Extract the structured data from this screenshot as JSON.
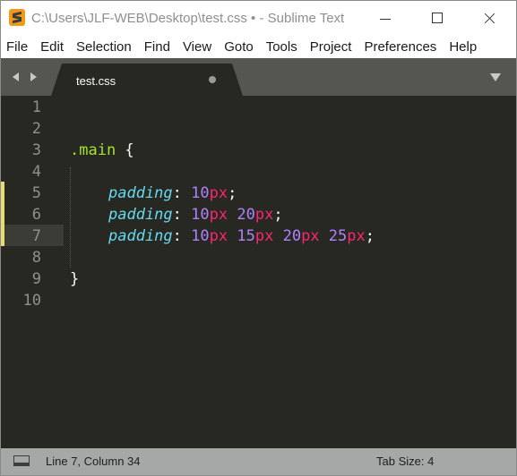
{
  "window": {
    "title": "C:\\Users\\JLF-WEB\\Desktop\\test.css • - Sublime Text"
  },
  "menu": [
    "File",
    "Edit",
    "Selection",
    "Find",
    "View",
    "Goto",
    "Tools",
    "Project",
    "Preferences",
    "Help"
  ],
  "tab": {
    "label": "test.css",
    "dirty": true
  },
  "editor": {
    "line_numbers": [
      "1",
      "2",
      "3",
      "4",
      "5",
      "6",
      "7",
      "8",
      "9",
      "10"
    ],
    "modified_lines": [
      5,
      6,
      7
    ],
    "current_line": 7,
    "code": {
      "l3_selector": ".main",
      "l3_brace": " {",
      "l5_prop": "padding",
      "l5_colon": ": ",
      "l5_n1": "10",
      "l5_u1": "px",
      "l5_end": ";",
      "l6_prop": "padding",
      "l6_colon": ": ",
      "l6_n1": "10",
      "l6_u1": "px",
      "l6_n2": "20",
      "l6_u2": "px",
      "l6_end": ";",
      "l7_prop": "padding",
      "l7_colon": ": ",
      "l7_n1": "10",
      "l7_u1": "px",
      "l7_n2": "15",
      "l7_u2": "px",
      "l7_n3": "20",
      "l7_u3": "px",
      "l7_n4": "25",
      "l7_u4": "px",
      "l7_end": ";",
      "l9_brace": "}"
    }
  },
  "status": {
    "position": "Line 7, Column 34",
    "tab_size": "Tab Size: 4"
  },
  "colors": {
    "editor_bg": "#272822",
    "selector": "#a6e22e",
    "property": "#66d9ef",
    "number": "#ae81ff",
    "unit": "#f92672",
    "modified_marker": "#e6db74"
  },
  "icons": [
    "sublime-text-icon",
    "minimize-icon",
    "maximize-icon",
    "close-icon",
    "tab-nav-left-icon",
    "tab-nav-right-icon",
    "unsaved-dot-icon",
    "tab-dropdown-icon",
    "toggle-panel-icon"
  ]
}
